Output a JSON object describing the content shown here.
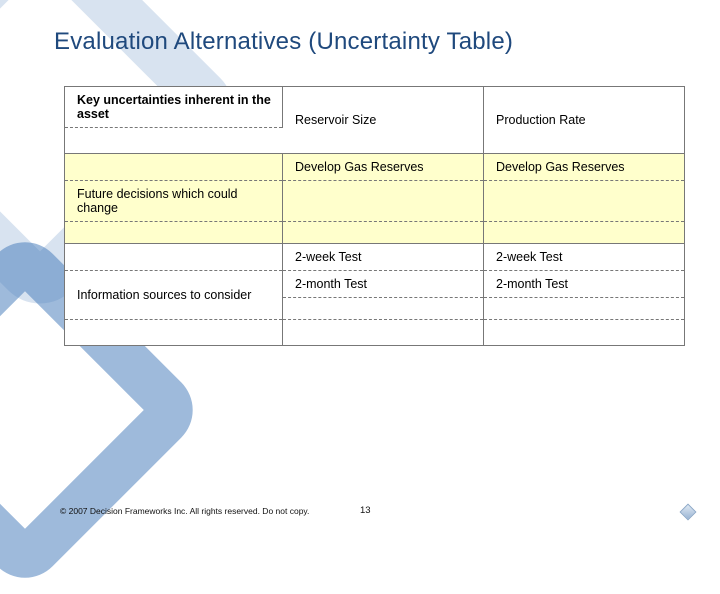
{
  "title": "Evaluation Alternatives (Uncertainty Table)",
  "table": {
    "headers": [
      "Key uncertainties inherent in the asset",
      "Reservoir Size",
      "Production Rate"
    ],
    "section2_label": "Future decisions which could change",
    "row2": [
      "Develop Gas Reserves",
      "Develop Gas Reserves"
    ],
    "section3_label": "Information sources to consider",
    "row_week": [
      "2-week Test",
      "2-week Test"
    ],
    "row_month": [
      "2-month Test",
      "2-month Test"
    ]
  },
  "footer": "© 2007 Decision Frameworks Inc. All rights reserved. Do not copy.",
  "page_number": "13"
}
